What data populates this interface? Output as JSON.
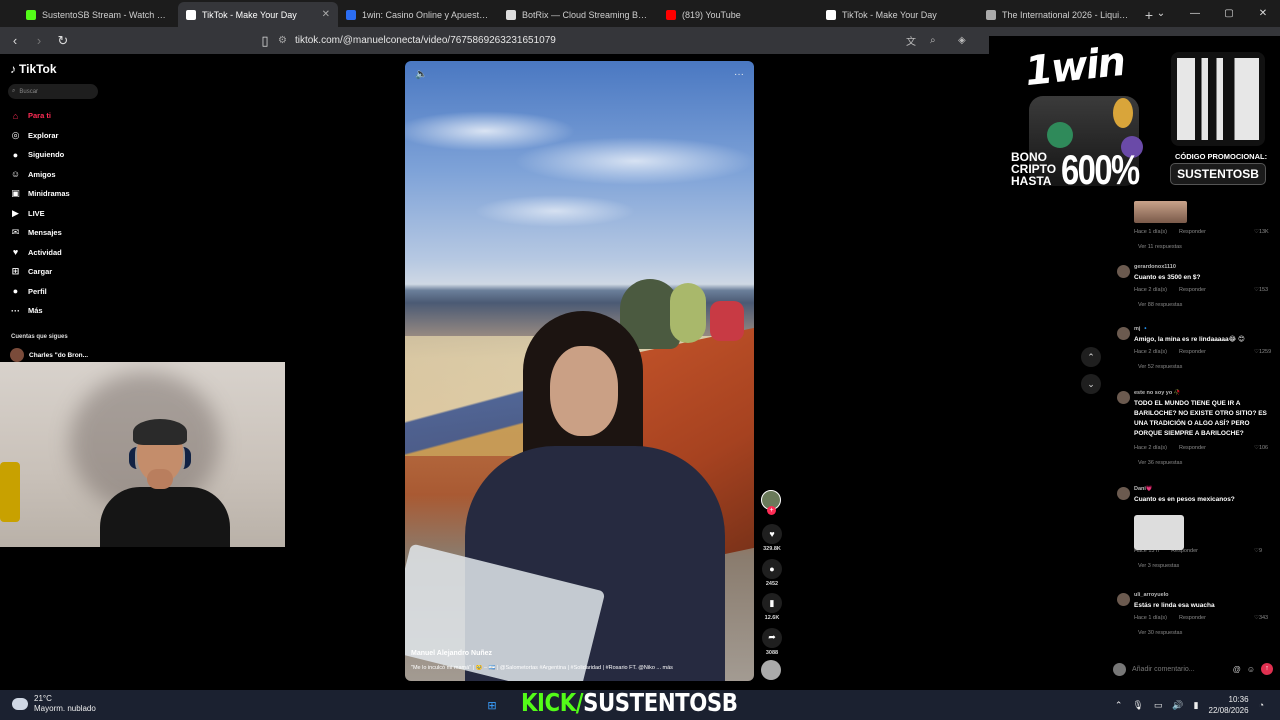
{
  "browser": {
    "tabs": [
      {
        "title": "SustentoSB Stream - Watch Live",
        "color": "#53fc18",
        "active": false
      },
      {
        "title": "TikTok - Make Your Day",
        "color": "#ffffff",
        "active": true
      },
      {
        "title": "1win: Casino Online y Apuestas Dep",
        "color": "#2b6df2",
        "active": false
      },
      {
        "title": "BotRix — Cloud Streaming Bot for",
        "color": "#dddddd",
        "active": false
      },
      {
        "title": "(819) YouTube",
        "color": "#ff0000",
        "active": false
      },
      {
        "title": "TikTok - Make Your Day",
        "color": "#ffffff",
        "active": false
      },
      {
        "title": "The International 2026 - Liquipedia",
        "color": "#aaaaaa",
        "active": false
      }
    ],
    "url": "tiktok.com/@manuelconecta/video/7675869263231651079"
  },
  "tiktok": {
    "logo": "TikTok",
    "search_placeholder": "Buscar",
    "nav": [
      {
        "label": "Para ti",
        "icon": "home-icon",
        "glyph": "⌂",
        "active": true
      },
      {
        "label": "Explorar",
        "icon": "compass-icon",
        "glyph": "◎",
        "active": false
      },
      {
        "label": "Siguiendo",
        "icon": "following-icon",
        "glyph": "●",
        "active": false
      },
      {
        "label": "Amigos",
        "icon": "friends-icon",
        "glyph": "☺",
        "active": false
      },
      {
        "label": "Minidramas",
        "icon": "film-icon",
        "glyph": "▣",
        "active": false
      },
      {
        "label": "LIVE",
        "icon": "live-icon",
        "glyph": "▶",
        "active": false
      },
      {
        "label": "Mensajes",
        "icon": "message-icon",
        "glyph": "✉",
        "active": false
      },
      {
        "label": "Actividad",
        "icon": "bell-icon",
        "glyph": "♥",
        "active": false
      },
      {
        "label": "Cargar",
        "icon": "upload-icon",
        "glyph": "⊞",
        "active": false
      },
      {
        "label": "Perfil",
        "icon": "profile-icon",
        "glyph": "●",
        "active": false
      },
      {
        "label": "Más",
        "icon": "more-icon",
        "glyph": "···",
        "active": false
      }
    ],
    "following_title": "Cuentas que sigues",
    "following": [
      {
        "name": "Charles \"do Bron..."
      }
    ],
    "video": {
      "author": "Manuel Alejandro Nuñez",
      "description": "\"Me lo inculcó mi mamá\" | 🥹 – 🇦🇷 | @Salometortas #Argentina | #Solidaridad | #Rosario FT. @Niko ... más"
    },
    "actions": [
      {
        "name": "like",
        "icon": "heart-icon",
        "glyph": "♥",
        "count": "329.8K"
      },
      {
        "name": "comment",
        "icon": "comment-icon",
        "glyph": "●",
        "count": "2452"
      },
      {
        "name": "save",
        "icon": "bookmark-icon",
        "glyph": "▮",
        "count": "12.6K"
      },
      {
        "name": "share",
        "icon": "share-icon",
        "glyph": "➦",
        "count": "3088"
      }
    ],
    "comments": {
      "items": [
        {
          "meta_time": "Hace 1 día(s)",
          "reply": "Responder",
          "likes": "13K",
          "more": "Ver 11 respuestas"
        },
        {
          "user": "gerardonox1110",
          "text": "Cuanto es 3500 en $?",
          "meta_time": "Hace 2 día(s)",
          "reply": "Responder",
          "likes": "153",
          "more": "Ver 88 respuestas"
        },
        {
          "user": "mj 🔹",
          "text": "Amigo, la mina es re lindaaaaa😂 😊",
          "meta_time": "Hace 2 día(s)",
          "reply": "Responder",
          "likes": "1259",
          "more": "Ver 52 respuestas"
        },
        {
          "user": "este no soy yo 🥀",
          "text": "TODO EL MUNDO TIENE QUE IR A BARILOCHE? NO EXISTE OTRO SITIO? ES UNA TRADICIÓN O ALGO ASÍ? PERO PORQUE SIEMPRE A BARILOCHE?",
          "meta_time": "Hace 2 día(s)",
          "reply": "Responder",
          "likes": "106",
          "more": "Ver 36 respuestas"
        },
        {
          "user": "Dani💗",
          "text": "Cuanto es en pesos mexicanos?",
          "meta_time": "Hace 13 h",
          "reply": "Responder",
          "likes": "9",
          "more": "Ver 3 respuestas"
        },
        {
          "user": "uli_arroyuelo",
          "text": "Estás re linda esa wuacha",
          "meta_time": "Hace 1 día(s)",
          "reply": "Responder",
          "likes": "343",
          "more": "Ver 30 respuestas"
        }
      ],
      "input_placeholder": "Añadir comentario..."
    }
  },
  "ad": {
    "brand": "1win",
    "bono": [
      "BONO",
      "CRIPTO",
      "HASTA"
    ],
    "percent": "600%",
    "code_label": "CÓDIGO PROMOCIONAL:",
    "code": "SUSTENTOSB"
  },
  "overlay": {
    "kick_prefix": "KICK/",
    "kick_channel": "SUSTENTOSB"
  },
  "taskbar": {
    "temp": "21°C",
    "weather": "Mayorm. nublado",
    "time": "10:36",
    "date": "22/08/2026"
  },
  "colors": {
    "accent": "#fe2c55",
    "kick": "#53fc18"
  }
}
